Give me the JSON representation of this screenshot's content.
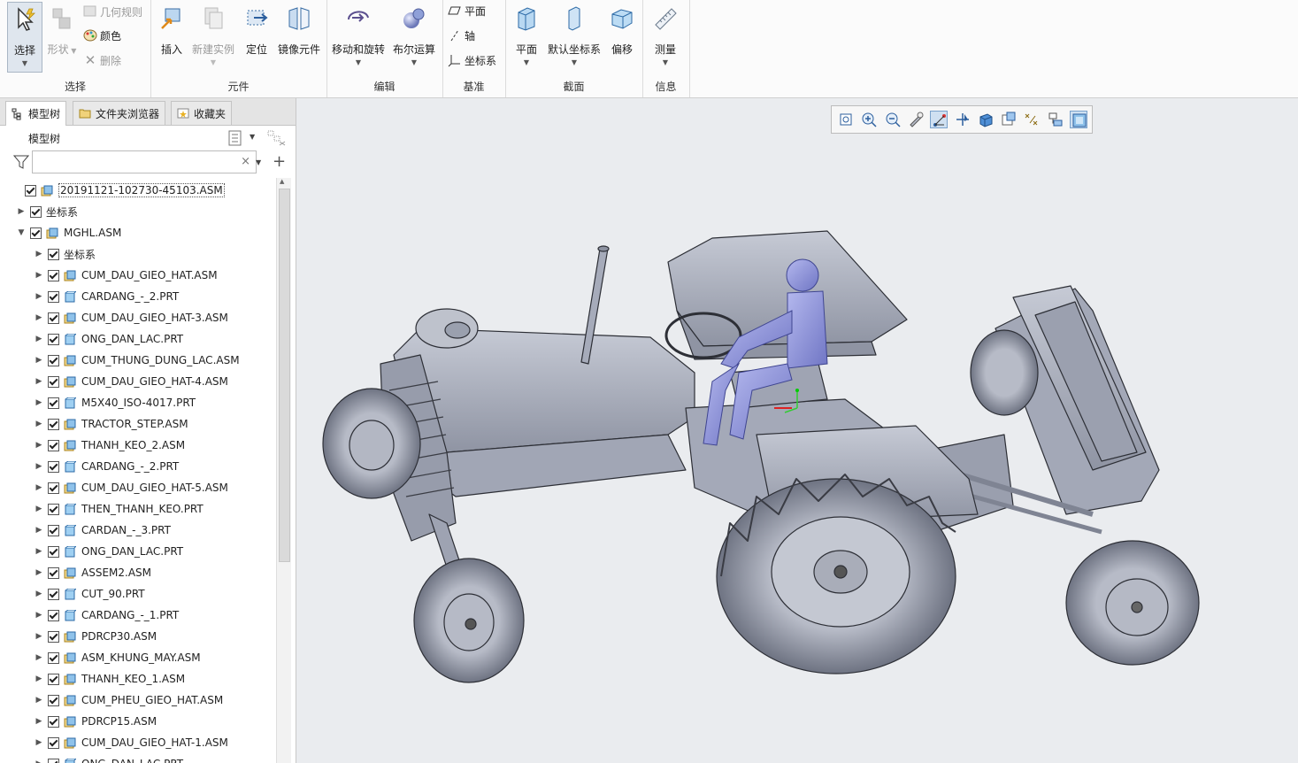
{
  "ribbon": {
    "groups": {
      "select": {
        "label": "选择",
        "select_btn": "选择",
        "shape_btn": "形状",
        "geom_rules": "几何规则",
        "color": "颜色",
        "delete": "删除"
      },
      "component": {
        "label": "元件",
        "insert": "插入",
        "new_instance": "新建实例",
        "locate": "定位",
        "mirror": "镜像元件"
      },
      "edit": {
        "label": "编辑",
        "move_rotate": "移动和旋转",
        "boolean": "布尔运算"
      },
      "datum": {
        "label": "基准",
        "plane": "平面",
        "axis": "轴",
        "csys": "坐标系"
      },
      "section": {
        "label": "截面",
        "plane": "平面",
        "default_csys": "默认坐标系",
        "offset": "偏移"
      },
      "info": {
        "label": "信息",
        "measure": "测量"
      }
    }
  },
  "panel": {
    "tabs": [
      "模型树",
      "文件夹浏览器",
      "收藏夹"
    ],
    "tree_title": "模型树",
    "search_clear": "×",
    "add_icon_glyph": "+",
    "items": [
      {
        "label": "20191121-102730-45103.ASM",
        "level": 0,
        "expander": "",
        "icon": "asm"
      },
      {
        "label": "坐标系",
        "level": 1,
        "expander": "▶",
        "icon": "none"
      },
      {
        "label": "MGHL.ASM",
        "level": 1,
        "expander": "▼",
        "icon": "asm"
      },
      {
        "label": "坐标系",
        "level": 2,
        "expander": "▶",
        "icon": "none"
      },
      {
        "label": "CUM_DAU_GIEO_HAT.ASM",
        "level": 2,
        "expander": "▶",
        "icon": "asm"
      },
      {
        "label": "CARDANG_-_2.PRT",
        "level": 2,
        "expander": "▶",
        "icon": "prt"
      },
      {
        "label": "CUM_DAU_GIEO_HAT-3.ASM",
        "level": 2,
        "expander": "▶",
        "icon": "asm"
      },
      {
        "label": "ONG_DAN_LAC.PRT",
        "level": 2,
        "expander": "▶",
        "icon": "prt"
      },
      {
        "label": "CUM_THUNG_DUNG_LAC.ASM",
        "level": 2,
        "expander": "▶",
        "icon": "asm"
      },
      {
        "label": "CUM_DAU_GIEO_HAT-4.ASM",
        "level": 2,
        "expander": "▶",
        "icon": "asm"
      },
      {
        "label": "M5X40_ISO-4017.PRT",
        "level": 2,
        "expander": "▶",
        "icon": "prt"
      },
      {
        "label": "TRACTOR_STEP.ASM",
        "level": 2,
        "expander": "▶",
        "icon": "asm"
      },
      {
        "label": "THANH_KEO_2.ASM",
        "level": 2,
        "expander": "▶",
        "icon": "asm"
      },
      {
        "label": "CARDANG_-_2.PRT",
        "level": 2,
        "expander": "▶",
        "icon": "prt"
      },
      {
        "label": "CUM_DAU_GIEO_HAT-5.ASM",
        "level": 2,
        "expander": "▶",
        "icon": "asm"
      },
      {
        "label": "THEN_THANH_KEO.PRT",
        "level": 2,
        "expander": "▶",
        "icon": "prt"
      },
      {
        "label": "CARDAN_-_3.PRT",
        "level": 2,
        "expander": "▶",
        "icon": "prt"
      },
      {
        "label": "ONG_DAN_LAC.PRT",
        "level": 2,
        "expander": "▶",
        "icon": "prt"
      },
      {
        "label": "ASSEM2.ASM",
        "level": 2,
        "expander": "▶",
        "icon": "asm"
      },
      {
        "label": "CUT_90.PRT",
        "level": 2,
        "expander": "▶",
        "icon": "prt"
      },
      {
        "label": "CARDANG_-_1.PRT",
        "level": 2,
        "expander": "▶",
        "icon": "prt"
      },
      {
        "label": "PDRCP30.ASM",
        "level": 2,
        "expander": "▶",
        "icon": "asm"
      },
      {
        "label": "ASM_KHUNG_MAY.ASM",
        "level": 2,
        "expander": "▶",
        "icon": "asm"
      },
      {
        "label": "THANH_KEO_1.ASM",
        "level": 2,
        "expander": "▶",
        "icon": "asm"
      },
      {
        "label": "CUM_PHEU_GIEO_HAT.ASM",
        "level": 2,
        "expander": "▶",
        "icon": "asm"
      },
      {
        "label": "PDRCP15.ASM",
        "level": 2,
        "expander": "▶",
        "icon": "asm"
      },
      {
        "label": "CUM_DAU_GIEO_HAT-1.ASM",
        "level": 2,
        "expander": "▶",
        "icon": "asm"
      },
      {
        "label": "ONG_DAN_LAC.PRT",
        "level": 2,
        "expander": "▶",
        "icon": "prt"
      }
    ]
  },
  "view_toolbar": {
    "icons": [
      "refit-icon",
      "zoom-in-icon",
      "zoom-out-icon",
      "repaint-icon",
      "datum-display-icon",
      "spin-center-icon",
      "display-style-icon",
      "saved-orientations-icon",
      "annotation-display-icon",
      "view-manager-icon",
      "shaded-icon"
    ],
    "active": [
      4,
      10
    ]
  },
  "colors": {
    "viewport_bg": "#eaecef",
    "model_body": "#a9aebd",
    "model_edge": "#2d2f36",
    "mannequin": "#8d93d8"
  }
}
